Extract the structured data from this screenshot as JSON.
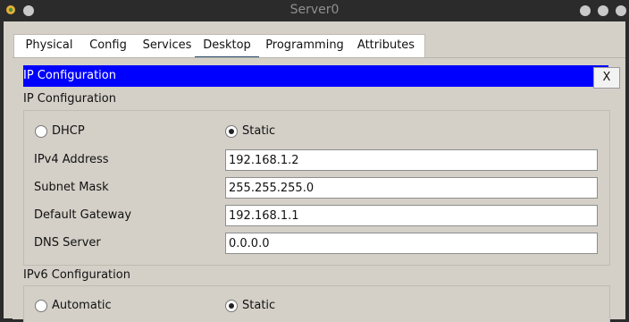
{
  "window": {
    "title": "Server0"
  },
  "tabs": [
    {
      "label": "Physical",
      "active": false
    },
    {
      "label": "Config",
      "active": false
    },
    {
      "label": "Services",
      "active": false
    },
    {
      "label": "Desktop",
      "active": true
    },
    {
      "label": "Programming",
      "active": false
    },
    {
      "label": "Attributes",
      "active": false
    }
  ],
  "ip_panel": {
    "header": "IP Configuration",
    "close_label": "X",
    "section_label": "IP Configuration",
    "mode_options": [
      {
        "label": "DHCP",
        "checked": false
      },
      {
        "label": "Static",
        "checked": true
      }
    ],
    "fields": [
      {
        "label": "IPv4 Address",
        "value": "192.168.1.2"
      },
      {
        "label": "Subnet Mask",
        "value": "255.255.255.0"
      },
      {
        "label": "Default Gateway",
        "value": "192.168.1.1"
      },
      {
        "label": "DNS Server",
        "value": "0.0.0.0"
      }
    ]
  },
  "ipv6": {
    "section_label": "IPv6 Configuration",
    "mode_options": [
      {
        "label": "Automatic",
        "checked": false
      },
      {
        "label": "Static",
        "checked": true
      }
    ]
  },
  "colors": {
    "header_blue": "#0000ff",
    "panel_gray": "#d4d0c8",
    "titlebar": "#2b2b2b",
    "active_tab_underline": "#2f4f6f"
  },
  "icons": {
    "app": "packet-tracer-app-icon",
    "window_buttons": [
      "window-control-icon",
      "minimize-icon",
      "maximize-icon",
      "close-window-icon"
    ]
  }
}
